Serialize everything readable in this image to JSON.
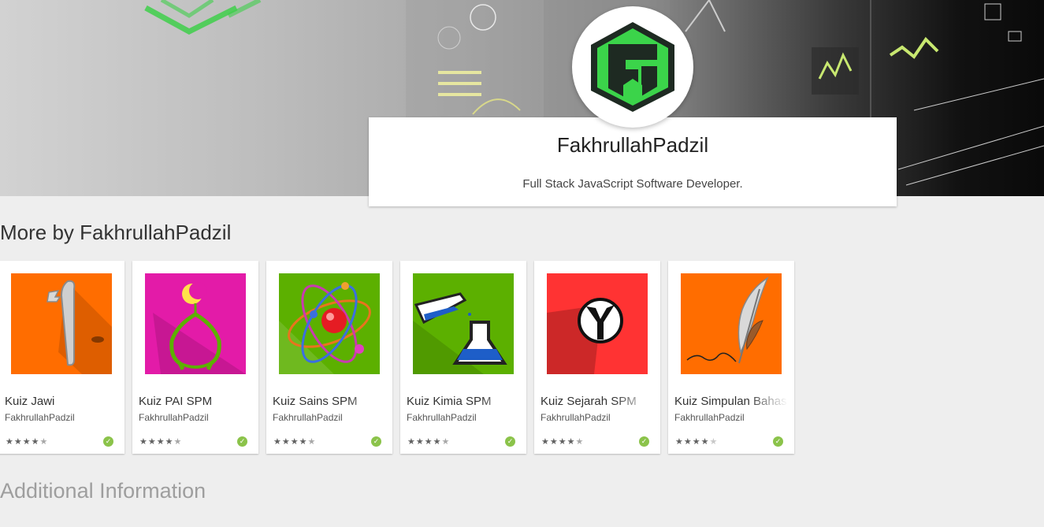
{
  "developer": {
    "name": "FakhrullahPadzil",
    "tagline": "Full Stack JavaScript Software Developer."
  },
  "more_by_title": "More by FakhrullahPadzil",
  "apps": [
    {
      "title": "Kuiz Jawi",
      "developer": "FakhrullahPadzil",
      "rating_stars": 4.5,
      "icon": "jawi-alif-icon",
      "bg": "#ff6d00"
    },
    {
      "title": "Kuiz PAI SPM",
      "developer": "FakhrullahPadzil",
      "rating_stars": 4.5,
      "icon": "mosque-dome-icon",
      "bg": "#e31ba8"
    },
    {
      "title": "Kuiz Sains SPM",
      "developer": "FakhrullahPadzil",
      "rating_stars": 4.5,
      "icon": "atom-icon",
      "bg": "#5cb000"
    },
    {
      "title": "Kuiz Kimia SPM",
      "developer": "FakhrullahPadzil",
      "rating_stars": 4.5,
      "icon": "chemistry-flask-icon",
      "bg": "#5cb000"
    },
    {
      "title": "Kuiz Sejarah SPM",
      "developer": "FakhrullahPadzil",
      "rating_stars": 4.5,
      "icon": "sejarah-emblem-icon",
      "bg": "#ff3333"
    },
    {
      "title": "Kuiz Simpulan Bahasa",
      "developer": "FakhrullahPadzil",
      "rating_stars": 4,
      "icon": "quill-feather-icon",
      "bg": "#ff6d00"
    }
  ],
  "additional_info_title": "Additional Information"
}
